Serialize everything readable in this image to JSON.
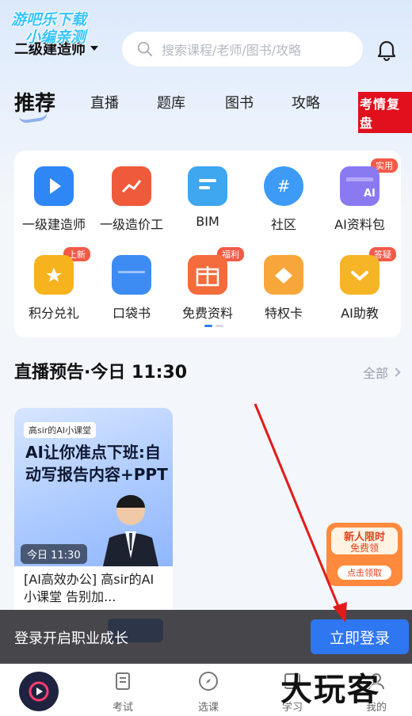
{
  "watermark": {
    "line1": "游吧乐下载",
    "line2": "小编亲测"
  },
  "header": {
    "exam_select": "二级建造师",
    "search_placeholder": "搜索课程/老师/图书/攻略"
  },
  "tabs": [
    {
      "label": "推荐",
      "active": true
    },
    {
      "label": "直播"
    },
    {
      "label": "题库"
    },
    {
      "label": "图书"
    },
    {
      "label": "攻略"
    }
  ],
  "hot_tag": "考情复盘",
  "grid": {
    "row1": [
      {
        "label": "一级建造师",
        "icon": "play-icon",
        "color": "#2f86f5"
      },
      {
        "label": "一级造价工",
        "icon": "chart-icon",
        "color": "#ef5a3a"
      },
      {
        "label": "BIM",
        "icon": "document-icon",
        "color": "#3fa6f0"
      },
      {
        "label": "社区",
        "icon": "chat-hash-icon",
        "color": "#3d9bf6"
      },
      {
        "label": "AI资料包",
        "icon": "gift-ai-icon",
        "color": "#8a7af2",
        "badge": "实用"
      }
    ],
    "row2": [
      {
        "label": "积分兑礼",
        "icon": "shopping-bag-icon",
        "color": "#f6b31e",
        "badge": "上新"
      },
      {
        "label": "口袋书",
        "icon": "folder-icon",
        "color": "#3d8cf3"
      },
      {
        "label": "免费资料",
        "icon": "gift-icon",
        "color": "#f46b3c",
        "badge": "福利"
      },
      {
        "label": "特权卡",
        "icon": "diamond-card-icon",
        "color": "#f7a63a"
      },
      {
        "label": "AI助教",
        "icon": "crown-icon",
        "color": "#f5b526",
        "badge": "答疑"
      }
    ]
  },
  "live": {
    "title": "直播预告·今日 11:30",
    "see_all": "全部",
    "card": {
      "tag": "高sir的AI小课堂",
      "headline": "AI让你准点下班:自动写报告内容+PPT",
      "time": "今日 11:30",
      "desc": "[AI高效办公] 高sir的AI小课堂 告别加..."
    }
  },
  "promo": {
    "line1": "新人限时",
    "line2": "免费领",
    "button": "点击领取"
  },
  "login_bar": {
    "text": "登录开启职业成长",
    "button": "立即登录"
  },
  "bottom_nav": [
    {
      "label": ""
    },
    {
      "label": "考试"
    },
    {
      "label": "选课"
    },
    {
      "label": "学习"
    },
    {
      "label": "我的"
    }
  ],
  "brand_watermark": "大玩客"
}
